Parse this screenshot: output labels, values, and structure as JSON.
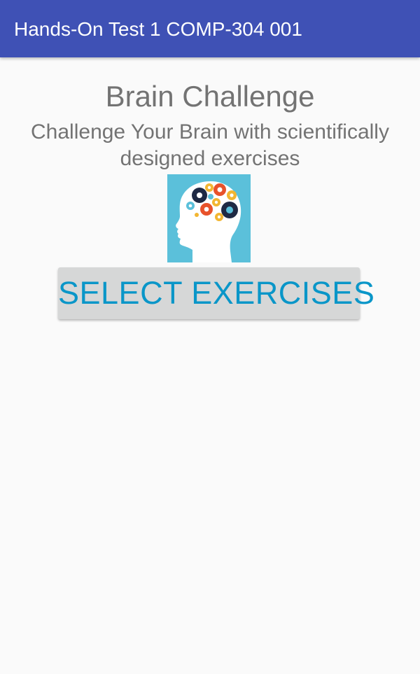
{
  "app_bar": {
    "title": "Hands-On Test 1 COMP-304 001"
  },
  "main": {
    "title": "Brain Challenge",
    "subtitle": "Challenge Your Brain with scientifically designed exercises",
    "image_icon": "brain-gears-icon",
    "select_button_label": "SELECT EXERCISES"
  },
  "colors": {
    "primary": "#3f51b5",
    "accent": "#0a96c8",
    "text_secondary": "#737373",
    "background": "#fafafa",
    "button_bg": "#d6d7d7",
    "image_bg": "#5bc0da"
  }
}
